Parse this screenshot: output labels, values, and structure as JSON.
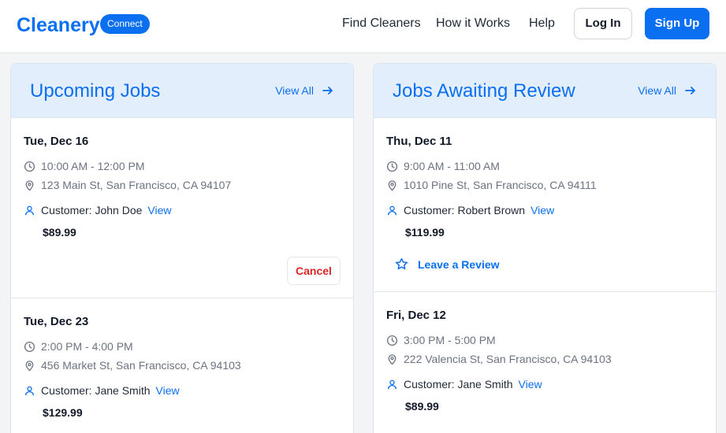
{
  "header": {
    "logo": "Cleanery",
    "badge": "Connect",
    "nav": [
      "Find Cleaners",
      "How it Works",
      "Help"
    ],
    "login": "Log In",
    "signup": "Sign Up"
  },
  "upcoming": {
    "title": "Upcoming Jobs",
    "view_all": "View All",
    "jobs": [
      {
        "date": "Tue, Dec 16",
        "time": "10:00 AM - 12:00 PM",
        "address": "123 Main St, San Francisco, CA 94107",
        "customer": "Customer: John Doe",
        "view": "View",
        "price": "$89.99",
        "action": "Cancel"
      },
      {
        "date": "Tue, Dec 23",
        "time": "2:00 PM - 4:00 PM",
        "address": "456 Market St, San Francisco, CA 94103",
        "customer": "Customer: Jane Smith",
        "view": "View",
        "price": "$129.99"
      }
    ]
  },
  "review": {
    "title": "Jobs Awaiting Review",
    "view_all": "View All",
    "jobs": [
      {
        "date": "Thu, Dec 11",
        "time": "9:00 AM - 11:00 AM",
        "address": "1010 Pine St, San Francisco, CA 94111",
        "customer": "Customer: Robert Brown",
        "view": "View",
        "price": "$119.99",
        "action": "Leave a Review"
      },
      {
        "date": "Fri, Dec 12",
        "time": "3:00 PM - 5:00 PM",
        "address": "222 Valencia St, San Francisco, CA 94103",
        "customer": "Customer: Jane Smith",
        "view": "View",
        "price": "$89.99"
      }
    ]
  }
}
